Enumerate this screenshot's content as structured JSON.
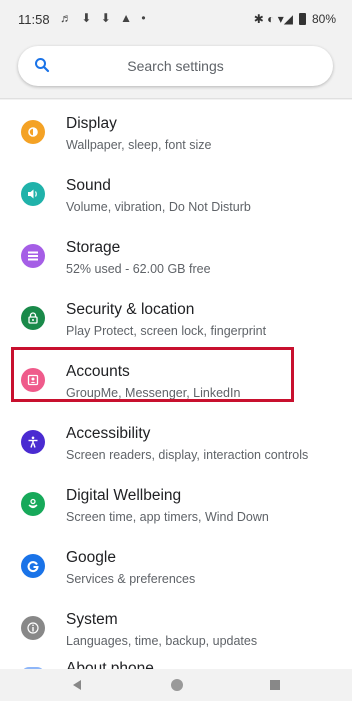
{
  "status_bar": {
    "time": "11:58",
    "notification_icons": "♬ ⬇ ⬇ ▲ •",
    "right_icons": "✱ ◐ ▾◢",
    "battery": "80%"
  },
  "search": {
    "placeholder": "Search settings"
  },
  "settings": [
    {
      "title": "Display",
      "subtitle": "Wallpaper, sleep, font size",
      "icon": "display-icon",
      "color": "#f4a225"
    },
    {
      "title": "Sound",
      "subtitle": "Volume, vibration, Do Not Disturb",
      "icon": "sound-icon",
      "color": "#20b2aa"
    },
    {
      "title": "Storage",
      "subtitle": "52% used - 62.00 GB free",
      "icon": "storage-icon",
      "color": "#a55ee6"
    },
    {
      "title": "Security & location",
      "subtitle": "Play Protect, screen lock, fingerprint",
      "icon": "lock-icon",
      "color": "#1a8a4a"
    },
    {
      "title": "Accounts",
      "subtitle": "GroupMe, Messenger, LinkedIn",
      "icon": "accounts-icon",
      "color": "#ef5b8b"
    },
    {
      "title": "Accessibility",
      "subtitle": "Screen readers, display, interaction controls",
      "icon": "accessibility-icon",
      "color": "#4a2bd1"
    },
    {
      "title": "Digital Wellbeing",
      "subtitle": "Screen time, app timers, Wind Down",
      "icon": "wellbeing-icon",
      "color": "#17a95a"
    },
    {
      "title": "Google",
      "subtitle": "Services & preferences",
      "icon": "google-icon",
      "color": "#1a73e8"
    },
    {
      "title": "System",
      "subtitle": "Languages, time, backup, updates",
      "icon": "info-icon",
      "color": "#888888"
    }
  ],
  "partial_item": {
    "title": "About phone"
  },
  "highlight_color": "#c8102e"
}
